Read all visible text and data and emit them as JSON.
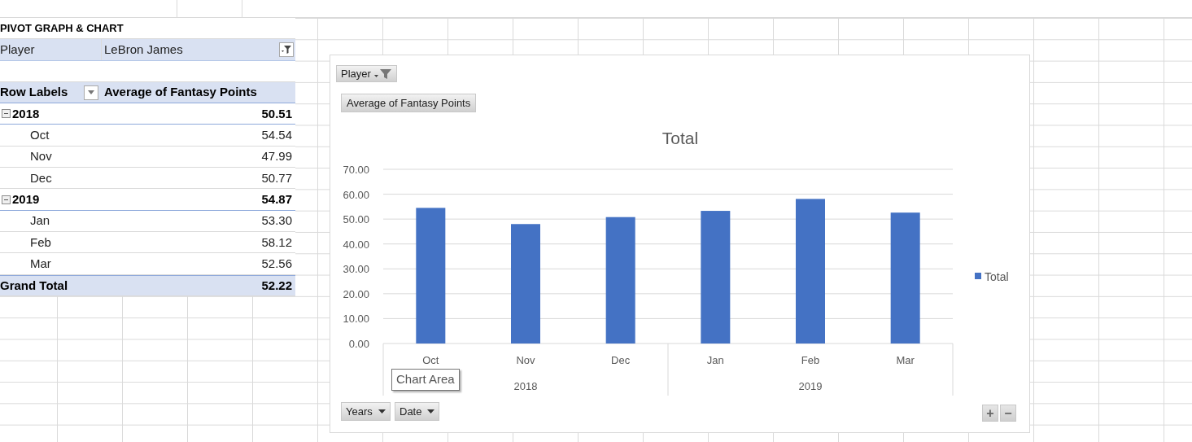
{
  "pivot": {
    "title": "PIVOT GRAPH & CHART",
    "filter": {
      "label": "Player",
      "value": "LeBron James"
    },
    "header": {
      "row_labels": "Row Labels",
      "values_label": "Average of Fantasy Points"
    },
    "groups": [
      {
        "label": "2018",
        "value": "50.51",
        "expanded": true,
        "children": [
          {
            "label": "Oct",
            "value": "54.54"
          },
          {
            "label": "Nov",
            "value": "47.99"
          },
          {
            "label": "Dec",
            "value": "50.77"
          }
        ]
      },
      {
        "label": "2019",
        "value": "54.87",
        "expanded": true,
        "children": [
          {
            "label": "Jan",
            "value": "53.30"
          },
          {
            "label": "Feb",
            "value": "58.12"
          },
          {
            "label": "Mar",
            "value": "52.56"
          }
        ]
      }
    ],
    "grand_total": {
      "label": "Grand Total",
      "value": "52.22"
    }
  },
  "chart": {
    "filter_button": "Player",
    "value_button": "Average of Fantasy Points",
    "axis_buttons": [
      "Years",
      "Date"
    ],
    "tooltip": "Chart Area",
    "zoom_buttons": [
      "+",
      "−"
    ],
    "year_groups": [
      {
        "label": "2018"
      },
      {
        "label": "2019"
      }
    ],
    "chart_data": {
      "type": "bar",
      "title": "Total",
      "grid": true,
      "categories": [
        "Oct",
        "Nov",
        "Dec",
        "Jan",
        "Feb",
        "Mar"
      ],
      "series": [
        {
          "name": "Total",
          "color": "#4472c4",
          "values": [
            54.5,
            48.0,
            50.8,
            53.3,
            58.1,
            52.6
          ]
        }
      ],
      "ylim": [
        0,
        70
      ],
      "yticks": [
        {
          "value": 0,
          "label": "0.00"
        },
        {
          "value": 10,
          "label": "10.00"
        },
        {
          "value": 20,
          "label": "20.00"
        },
        {
          "value": 30,
          "label": "30.00"
        },
        {
          "value": 40,
          "label": "40.00"
        },
        {
          "value": 50,
          "label": "50.00"
        },
        {
          "value": 60,
          "label": "60.00"
        },
        {
          "value": 70,
          "label": "70.00"
        }
      ]
    }
  }
}
